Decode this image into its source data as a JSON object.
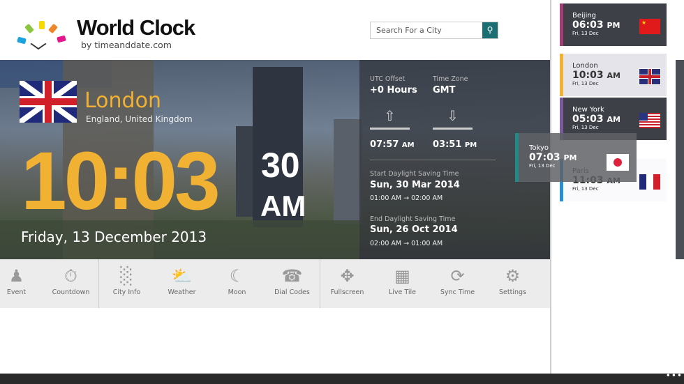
{
  "header": {
    "title": "World Clock",
    "subtitle": "by timeanddate.com",
    "search_placeholder": "Search For a City"
  },
  "main": {
    "city": "London",
    "region": "England, United Kingdom",
    "time": "10:03",
    "seconds": "30",
    "ampm": "AM",
    "date": "Friday, 13 December 2013",
    "accent": "#f1b132"
  },
  "info": {
    "utc_label": "UTC Offset",
    "utc_value": "+0 Hours",
    "tz_label": "Time Zone",
    "tz_value": "GMT",
    "sunrise": "07:57",
    "sunrise_ampm": "AM",
    "sunset": "03:51",
    "sunset_ampm": "PM",
    "dst_start_label": "Start Daylight Saving Time",
    "dst_start_date": "Sun, 30 Mar 2014",
    "dst_start_change": "01:00 AM → 02:00 AM",
    "dst_end_label": "End Daylight Saving Time",
    "dst_end_date": "Sun, 26 Oct 2014",
    "dst_end_change": "02:00 AM → 01:00 AM"
  },
  "toolbar": [
    {
      "label": "Event",
      "icon": "people-icon"
    },
    {
      "label": "Countdown",
      "icon": "stopwatch-icon"
    },
    {
      "label": "City Info",
      "icon": "skyline-icon"
    },
    {
      "label": "Weather",
      "icon": "weather-icon"
    },
    {
      "label": "Moon",
      "icon": "moon-icon"
    },
    {
      "label": "Dial Codes",
      "icon": "phone-icon"
    },
    {
      "label": "Fullscreen",
      "icon": "fullscreen-icon"
    },
    {
      "label": "Live Tile",
      "icon": "tile-icon"
    },
    {
      "label": "Sync Time",
      "icon": "sync-icon"
    },
    {
      "label": "Settings",
      "icon": "gear-icon"
    }
  ],
  "cities": [
    {
      "city": "Beijing",
      "time": "06:03",
      "ampm": "PM",
      "date": "Fri, 13 Dec",
      "bar": "#a43c7a"
    },
    {
      "city": "London",
      "time": "10:03",
      "ampm": "AM",
      "date": "Fri, 13 Dec",
      "bar": "#f1b132"
    },
    {
      "city": "New York",
      "time": "05:03",
      "ampm": "AM",
      "date": "Fri, 13 Dec",
      "bar": "#7a5a9a"
    },
    {
      "city": "Paris",
      "time": "11:03",
      "ampm": "AM",
      "date": "Fri, 13 Dec",
      "bar": "#2a8fd0"
    },
    {
      "city": "Tokyo",
      "time": "07:03",
      "ampm": "PM",
      "date": "Fri, 13 Dec",
      "bar": "#1f8a86"
    }
  ]
}
